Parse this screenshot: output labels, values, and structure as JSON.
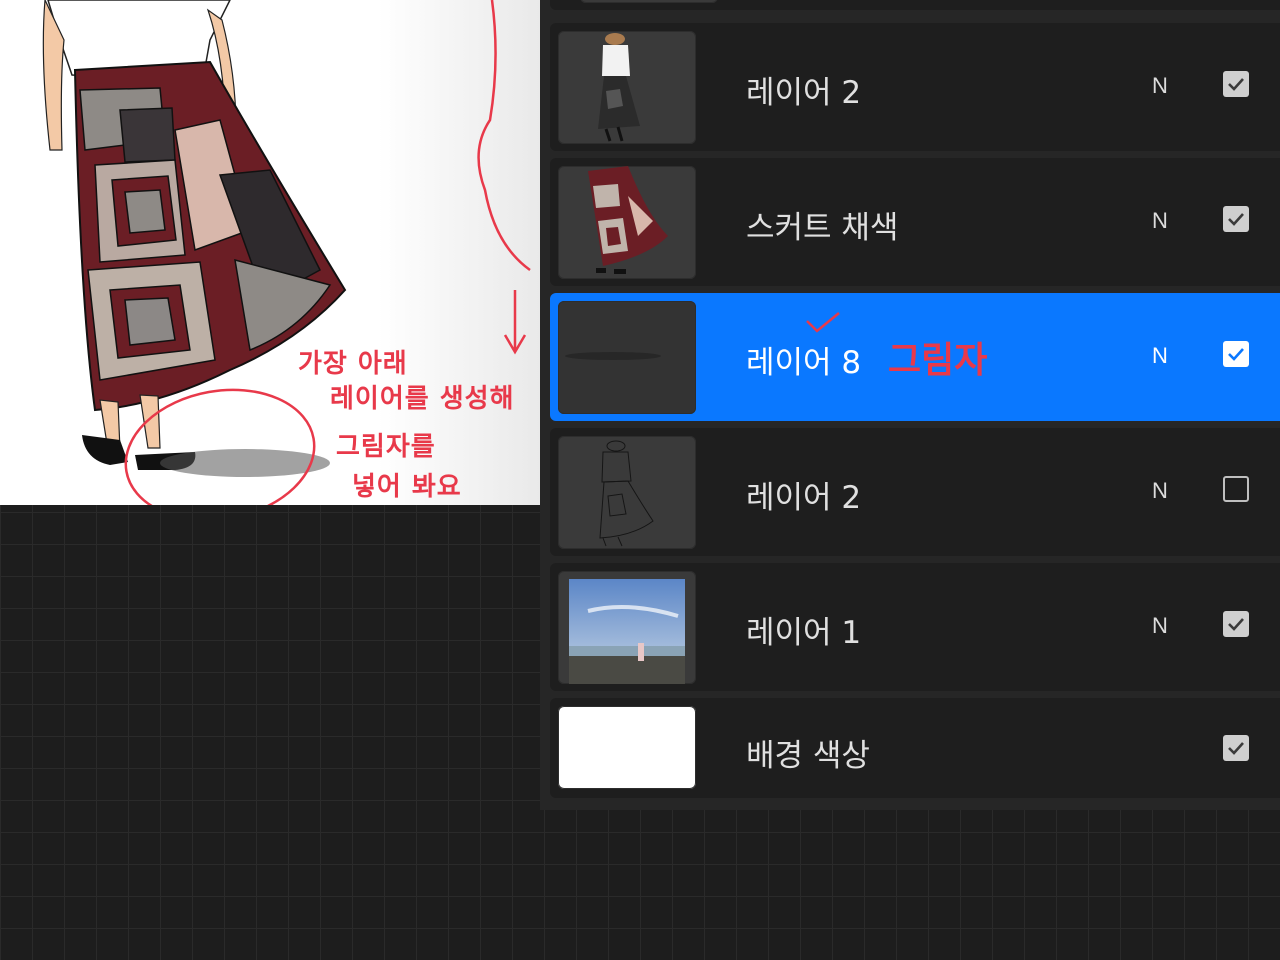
{
  "canvas": {
    "annotations": [
      "가장 아래",
      "레이어를 생성해",
      "그림자를",
      "넣어 봐요"
    ]
  },
  "layers_panel": {
    "layers": [
      {
        "name": "레이어 2",
        "blend": "N",
        "visible": true,
        "selected": false,
        "thumbnail": "figure-color-thumbnail"
      },
      {
        "name": "스커트 채색",
        "blend": "N",
        "visible": true,
        "selected": false,
        "thumbnail": "skirt-color-thumbnail"
      },
      {
        "name": "레이어 8",
        "blend": "N",
        "visible": true,
        "selected": true,
        "thumbnail": "shadow-thumbnail",
        "annotation": "그림자"
      },
      {
        "name": "레이어 2",
        "blend": "N",
        "visible": false,
        "selected": false,
        "thumbnail": "line-sketch-thumbnail"
      },
      {
        "name": "레이어 1",
        "blend": "N",
        "visible": true,
        "selected": false,
        "thumbnail": "photo-thumbnail"
      },
      {
        "name": "배경 색상",
        "blend": "",
        "visible": true,
        "selected": false,
        "thumbnail": "white-background-thumbnail"
      }
    ]
  },
  "colors": {
    "accent": "#0a78ff",
    "annotation": "#e8394a",
    "panel_bg": "#262626",
    "row_bg": "#1e1e1e"
  }
}
